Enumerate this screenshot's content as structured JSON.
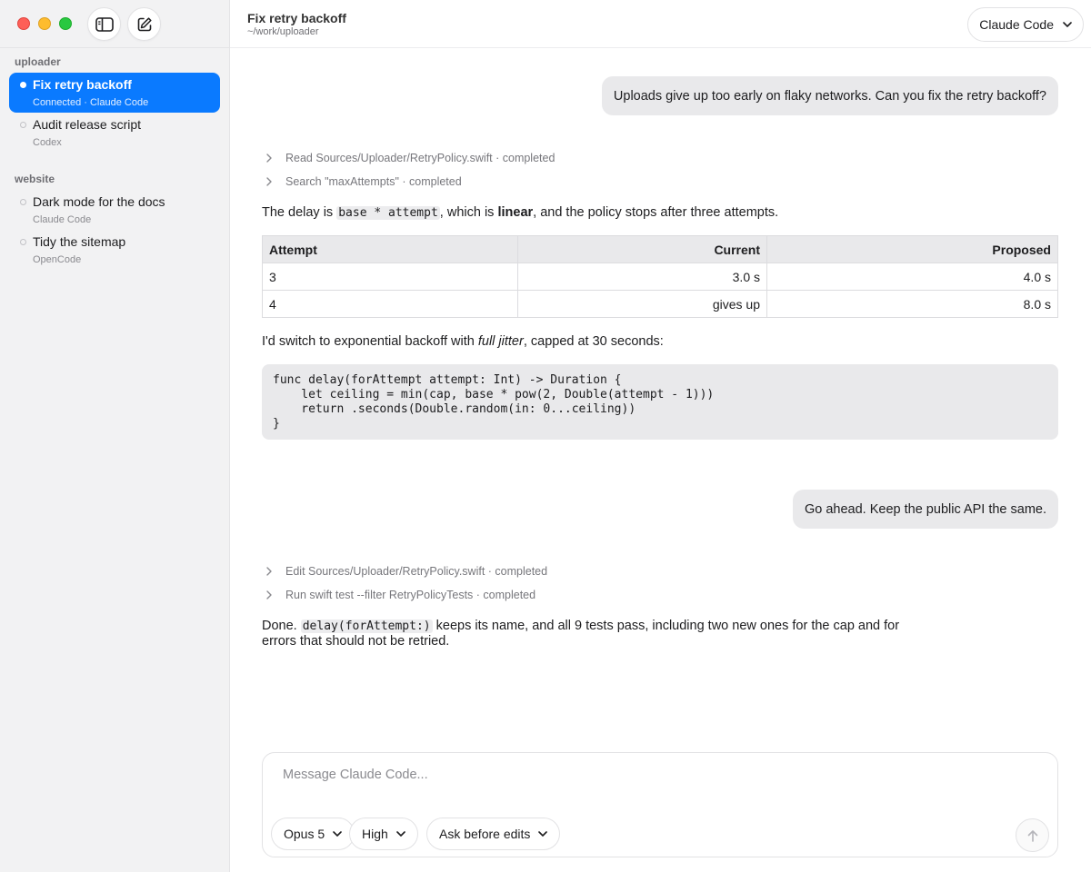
{
  "sidebar": {
    "groups": [
      {
        "label": "uploader",
        "sessions": [
          {
            "title": "Fix retry backoff",
            "subtitle": "Connected · Claude Code",
            "active": true
          },
          {
            "title": "Audit release script",
            "subtitle": "Codex",
            "active": false
          }
        ]
      },
      {
        "label": "website",
        "sessions": [
          {
            "title": "Dark mode for the docs",
            "subtitle": "Claude Code",
            "active": false
          },
          {
            "title": "Tidy the sitemap",
            "subtitle": "OpenCode",
            "active": false
          }
        ]
      }
    ]
  },
  "header": {
    "title": "Fix retry backoff",
    "path": "~/work/uploader",
    "agent": "Claude Code"
  },
  "chat": {
    "user_message_1": "Uploads give up too early on flaky networks. Can you fix the retry backoff?",
    "tool_calls_1": [
      "Read Sources/Uploader/RetryPolicy.swift · completed",
      "Search \"maxAttempts\" · completed"
    ],
    "reply_1": {
      "before_code": "The delay is ",
      "code": "base * attempt",
      "middle": ", which is ",
      "bold": "linear",
      "after": ", and the policy stops after three attempts."
    },
    "table": {
      "headers": [
        "Attempt",
        "Current",
        "Proposed"
      ],
      "rows": [
        [
          "3",
          "3.0 s",
          "4.0 s"
        ],
        [
          "4",
          "gives up",
          "8.0 s"
        ]
      ]
    },
    "reply_2": {
      "before": "I'd switch to exponential backoff with ",
      "italic": "full jitter",
      "after": ", capped at 30 seconds:"
    },
    "code_block": "func delay(forAttempt attempt: Int) -> Duration {\n    let ceiling = min(cap, base * pow(2, Double(attempt - 1)))\n    return .seconds(Double.random(in: 0...ceiling))\n}",
    "user_message_2": "Go ahead. Keep the public API the same.",
    "tool_calls_2": [
      "Edit Sources/Uploader/RetryPolicy.swift · completed",
      "Run swift test --filter RetryPolicyTests · completed"
    ],
    "reply_3": {
      "before": "Done. ",
      "code": "delay(forAttempt:)",
      "after_line1": " keeps its name, and all 9 tests pass, including two new ones for the cap and for",
      "line2": "errors that should not be retried."
    }
  },
  "composer": {
    "placeholder": "Message Claude Code...",
    "model": "Opus 5",
    "effort": "High",
    "permission_mode": "Ask before edits"
  },
  "colors": {
    "accent": "#0a7aff",
    "sidebar_bg": "#f2f2f3",
    "bubble_bg": "#e9e9eb"
  },
  "icons": {
    "sidebar_toggle": "sidebar-icon",
    "compose": "compose-icon",
    "send": "arrow-up-icon"
  }
}
